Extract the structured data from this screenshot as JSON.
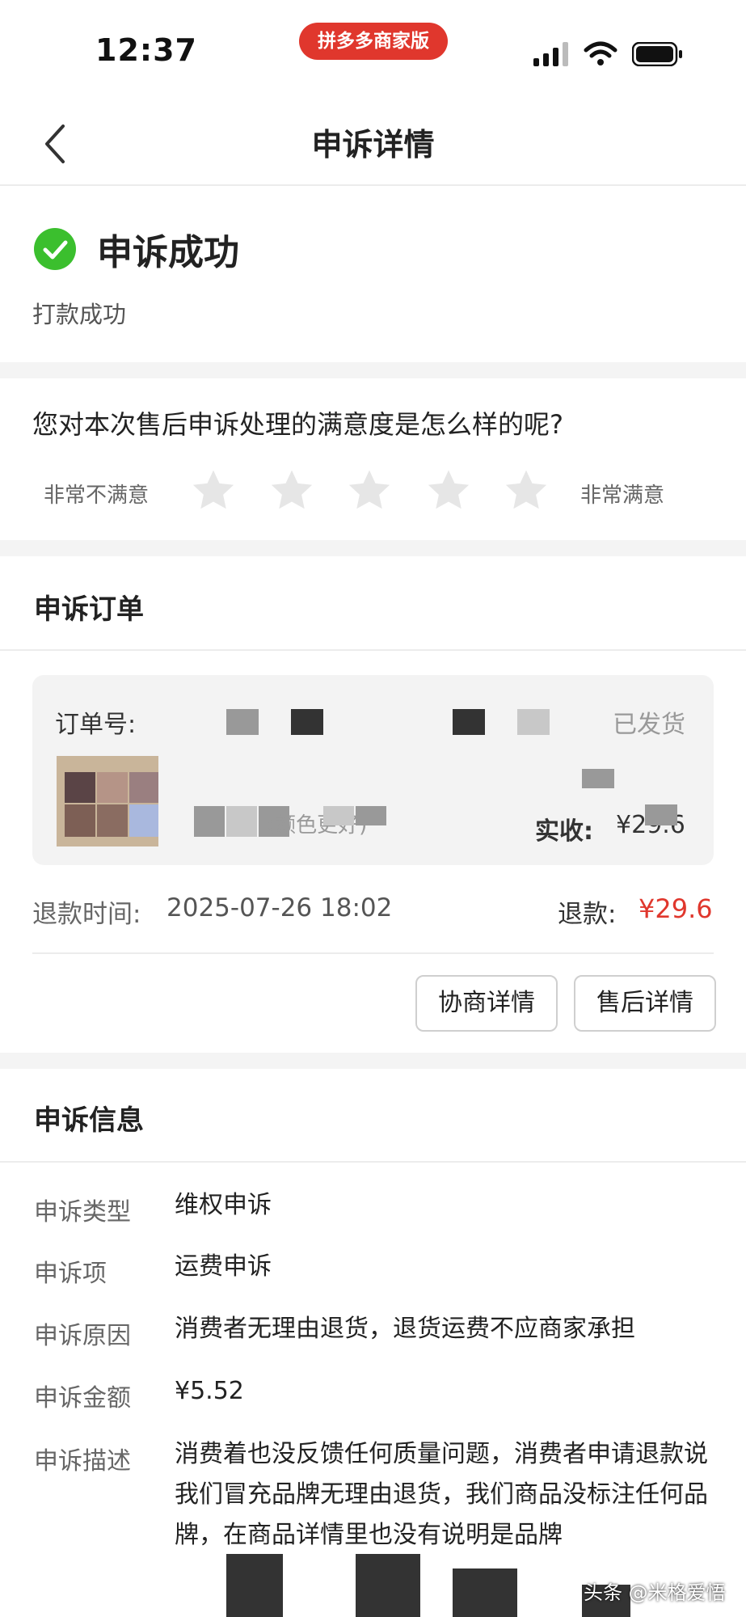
{
  "status_bar": {
    "time": "12:37",
    "app_badge": "拼多多商家版",
    "icons": [
      "signal-icon",
      "wifi-icon",
      "battery-icon"
    ]
  },
  "nav": {
    "title": "申诉详情",
    "back_icon": "chevron-left-icon"
  },
  "result": {
    "title": "申诉成功",
    "subtitle": "打款成功",
    "icon": "check-circle-icon",
    "icon_color": "#3bbf2e"
  },
  "rating": {
    "question": "您对本次售后申诉处理的满意度是怎么样的呢?",
    "left_label": "非常不满意",
    "right_label": "非常满意",
    "stars_total": 5,
    "stars_selected": 0,
    "star_color": "#e6e6e6"
  },
  "order": {
    "section_title": "申诉订单",
    "order_no_label": "订单号:",
    "status": "已发货",
    "name_fragment": "(颜色更好)",
    "paid_label": "实收:",
    "paid_value": "¥29.6",
    "refund_time_label": "退款时间:",
    "refund_time": "2025-07-26 18:02",
    "refund_label": "退款:",
    "refund_value": "¥29.6",
    "refund_color": "#e0372d",
    "buttons": [
      "协商详情",
      "售后详情"
    ]
  },
  "appeal": {
    "section_title": "申诉信息",
    "rows": [
      {
        "label": "申诉类型",
        "value": "维权申诉"
      },
      {
        "label": "申诉项",
        "value": "运费申诉"
      },
      {
        "label": "申诉原因",
        "value": "消费者无理由退货，退货运费不应商家承担"
      },
      {
        "label": "申诉金额",
        "value": "¥5.52"
      },
      {
        "label": "申诉描述",
        "value": "消费着也没反馈任何质量问题，消费者申请退款说我们冒充品牌无理由退货，我们商品没标注任何品牌，在商品详情里也没有说明是品牌"
      }
    ]
  },
  "watermark": "头条 @米格爱悟"
}
